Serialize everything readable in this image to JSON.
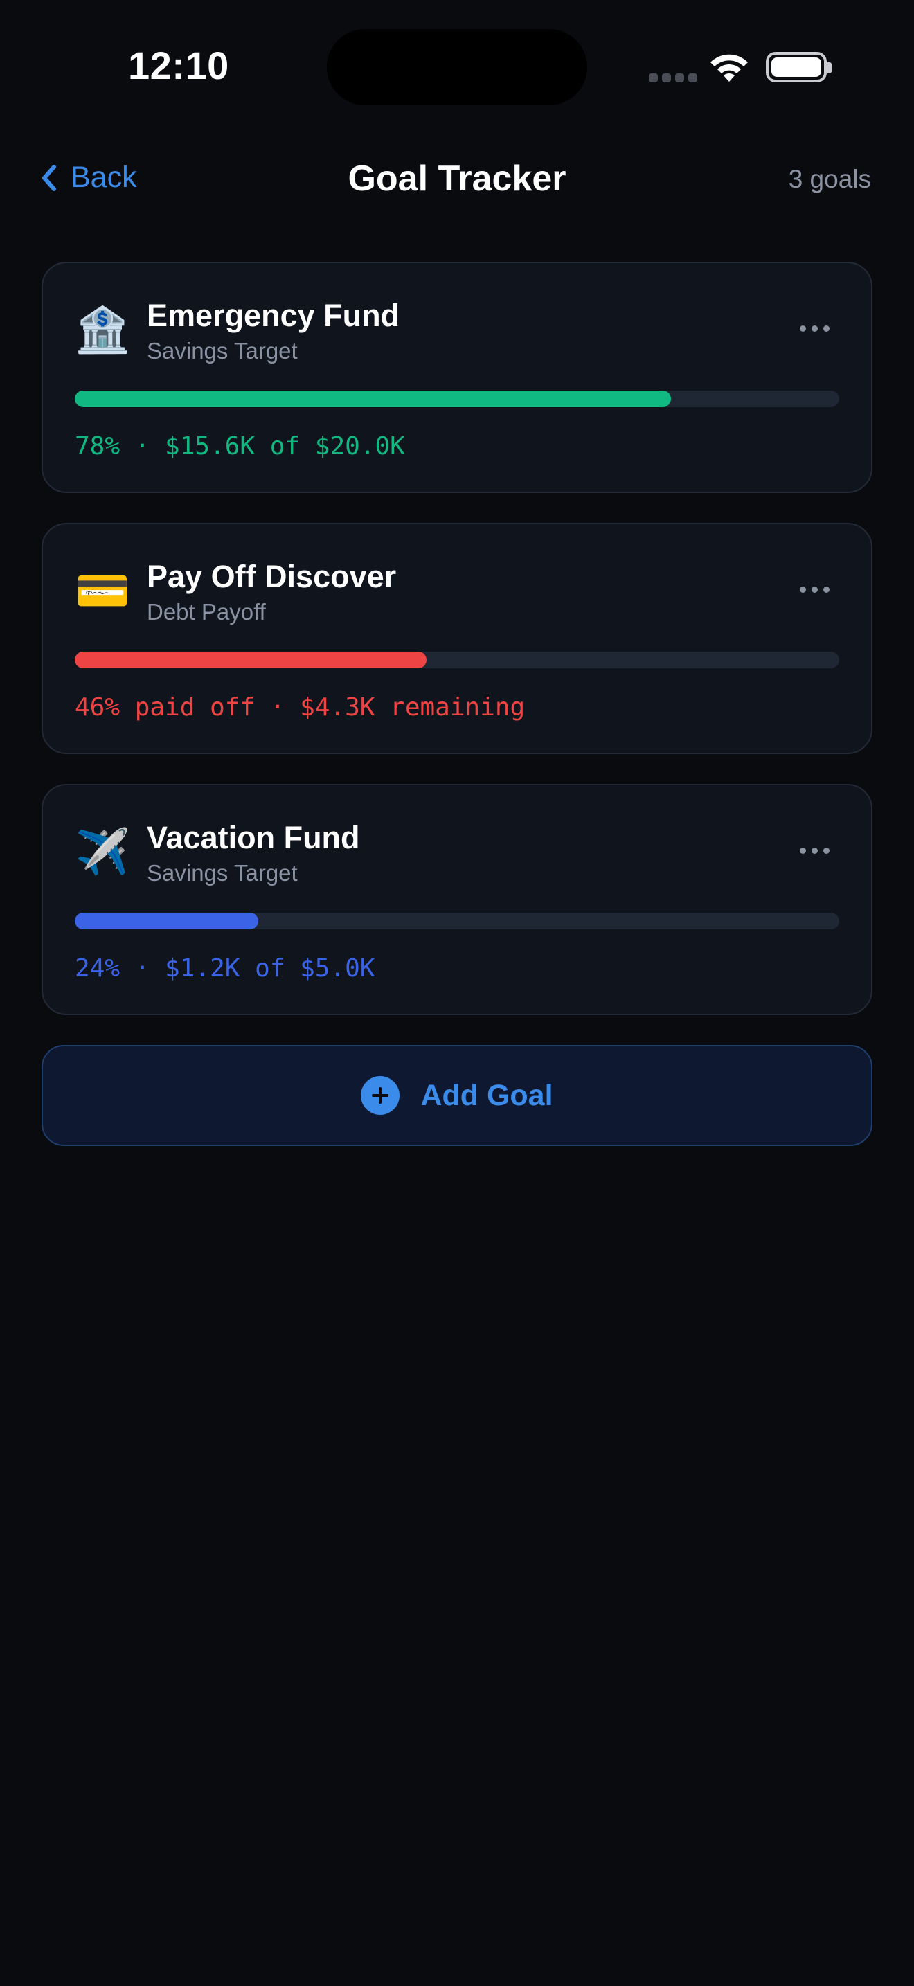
{
  "status_bar": {
    "time": "12:10"
  },
  "nav": {
    "back_label": "Back",
    "title": "Goal Tracker",
    "count": "3 goals"
  },
  "goals": [
    {
      "icon": "🏦",
      "icon_name": "bank-icon",
      "title": "Emergency Fund",
      "subtitle": "Savings Target",
      "progress": 0.78,
      "meta": "78% · $15.6K of $20.0K",
      "color": "#10b981"
    },
    {
      "icon": "💳",
      "icon_name": "credit-card-icon",
      "title": "Pay Off Discover",
      "subtitle": "Debt Payoff",
      "progress": 0.46,
      "meta": "46% paid off · $4.3K remaining",
      "color": "#ef4444"
    },
    {
      "icon": "✈️",
      "icon_name": "airplane-icon",
      "title": "Vacation Fund",
      "subtitle": "Savings Target",
      "progress": 0.24,
      "meta": "24% · $1.2K of $5.0K",
      "color": "#3b63e6"
    }
  ],
  "add_goal": {
    "label": "Add Goal"
  },
  "colors": {
    "accent": "#3b8bea",
    "background": "#0a0b0f",
    "card": "#10141c"
  }
}
